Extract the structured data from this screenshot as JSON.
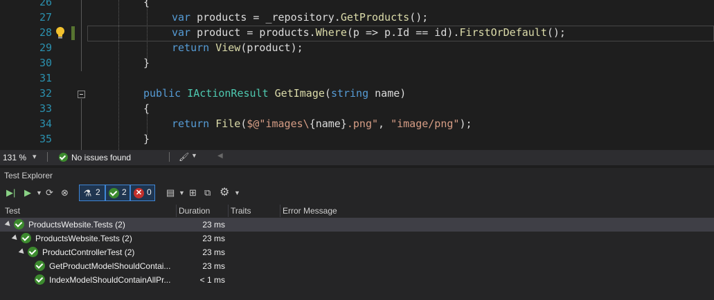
{
  "editor": {
    "lines": [
      {
        "number": "26",
        "tokens": [
          {
            "t": "{",
            "c": "punct"
          }
        ]
      },
      {
        "number": "27",
        "tokens": [
          {
            "t": "var",
            "c": "keyword"
          },
          {
            "t": " products = _repository.",
            "c": "plain"
          },
          {
            "t": "GetProducts",
            "c": "method"
          },
          {
            "t": "();",
            "c": "plain"
          }
        ]
      },
      {
        "number": "28",
        "tokens": [
          {
            "t": "var",
            "c": "keyword"
          },
          {
            "t": " product = products.",
            "c": "plain"
          },
          {
            "t": "Where",
            "c": "method"
          },
          {
            "t": "(p => p.Id == id).",
            "c": "plain"
          },
          {
            "t": "FirstOrDefault",
            "c": "method"
          },
          {
            "t": "();",
            "c": "plain"
          }
        ]
      },
      {
        "number": "29",
        "tokens": [
          {
            "t": "return",
            "c": "keyword"
          },
          {
            "t": " ",
            "c": "plain"
          },
          {
            "t": "View",
            "c": "method"
          },
          {
            "t": "(product);",
            "c": "plain"
          }
        ]
      },
      {
        "number": "30",
        "tokens": [
          {
            "t": "}",
            "c": "punct"
          }
        ]
      },
      {
        "number": "31",
        "tokens": []
      },
      {
        "number": "32",
        "tokens": [
          {
            "t": "public",
            "c": "keyword"
          },
          {
            "t": " ",
            "c": "plain"
          },
          {
            "t": "IActionResult",
            "c": "type"
          },
          {
            "t": " ",
            "c": "plain"
          },
          {
            "t": "GetImage",
            "c": "method"
          },
          {
            "t": "(",
            "c": "plain"
          },
          {
            "t": "string",
            "c": "keyword"
          },
          {
            "t": " name)",
            "c": "plain"
          }
        ]
      },
      {
        "number": "33",
        "tokens": [
          {
            "t": "{",
            "c": "punct"
          }
        ]
      },
      {
        "number": "34",
        "tokens": [
          {
            "t": "return",
            "c": "keyword"
          },
          {
            "t": " ",
            "c": "plain"
          },
          {
            "t": "File",
            "c": "method"
          },
          {
            "t": "(",
            "c": "plain"
          },
          {
            "t": "$@\"images\\",
            "c": "string"
          },
          {
            "t": "{name}",
            "c": "plain"
          },
          {
            "t": ".png\"",
            "c": "string"
          },
          {
            "t": ", ",
            "c": "plain"
          },
          {
            "t": "\"image/png\"",
            "c": "string"
          },
          {
            "t": ");",
            "c": "plain"
          }
        ]
      },
      {
        "number": "35",
        "tokens": [
          {
            "t": "}",
            "c": "punct"
          }
        ]
      }
    ]
  },
  "status": {
    "zoom": "131 %",
    "issues": "No issues found"
  },
  "test_explorer": {
    "title": "Test Explorer",
    "filters": {
      "total": "2",
      "passed": "2",
      "failed": "0"
    },
    "columns": {
      "test": "Test",
      "duration": "Duration",
      "traits": "Traits",
      "error": "Error Message"
    },
    "rows": [
      {
        "name": "ProductsWebsite.Tests (2)",
        "duration": "23 ms"
      },
      {
        "name": "ProductsWebsite.Tests (2)",
        "duration": "23 ms"
      },
      {
        "name": "ProductControllerTest (2)",
        "duration": "23 ms"
      },
      {
        "name": "GetProductModelShouldContai...",
        "duration": "23 ms"
      },
      {
        "name": "IndexModelShouldContainAllPr...",
        "duration": "< 1 ms"
      }
    ]
  },
  "colors": {
    "keyword": "#569cd6",
    "type": "#4ec9b0",
    "method": "#dcdcaa",
    "string": "#d69d85",
    "line_number": "#2b91af",
    "pass": "#3c8a2e",
    "fail": "#c4302b"
  },
  "icons": [
    "lightbulb-icon",
    "no-issues-icon",
    "brush-icon",
    "run-all-icon",
    "run-icon",
    "rerun-icon",
    "cancel-icon",
    "flask-icon",
    "passed-icon",
    "failed-icon",
    "playlist-icon",
    "group-by-icon",
    "expand-icon",
    "settings-icon"
  ]
}
